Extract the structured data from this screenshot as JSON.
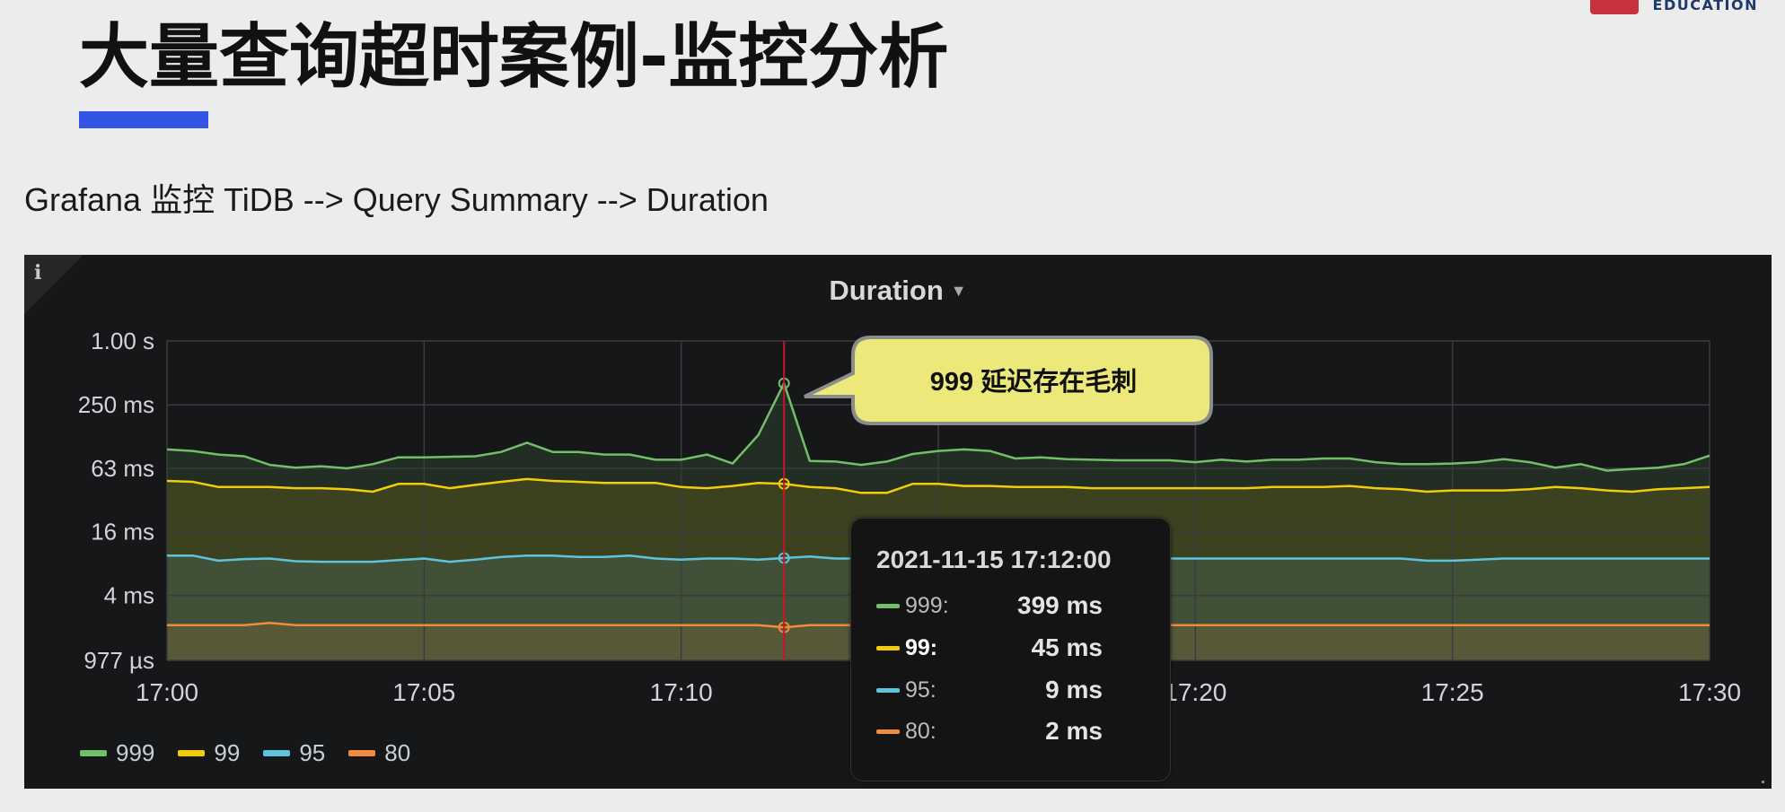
{
  "logo": {
    "text": "EDUCATION",
    "brand_color": "#c8323c"
  },
  "slide": {
    "title": "大量查询超时案例-监控分析",
    "subtitle": "Grafana 监控 TiDB --> Query Summary --> Duration",
    "accent_color": "#3355e6"
  },
  "panel": {
    "info_icon": "i",
    "title": "Duration",
    "menu_icon": "caret-down-icon",
    "background": "#161719"
  },
  "annotation": {
    "text": "999 延迟存在毛刺",
    "fill": "#ece879"
  },
  "tooltip": {
    "time": "2021-11-15 17:12:00",
    "rows": [
      {
        "name": "999:",
        "value": "399 ms",
        "color": "#73bf69",
        "highlight": false
      },
      {
        "name": "99:",
        "value": "45 ms",
        "color": "#f2cc0c",
        "highlight": true
      },
      {
        "name": "95:",
        "value": "9 ms",
        "color": "#5ec4dd",
        "highlight": false
      },
      {
        "name": "80:",
        "value": "2 ms",
        "color": "#f28c3c",
        "highlight": false
      }
    ]
  },
  "chart_data": {
    "type": "area",
    "title": "Duration",
    "y_scale": "log2",
    "ylim": [
      0.000977,
      1.0
    ],
    "y_ticks": [
      {
        "value": 1.0,
        "label": "1.00 s"
      },
      {
        "value": 0.25,
        "label": "250 ms"
      },
      {
        "value": 0.063,
        "label": "63 ms"
      },
      {
        "value": 0.016,
        "label": "16 ms"
      },
      {
        "value": 0.004,
        "label": "4 ms"
      },
      {
        "value": 0.000977,
        "label": "977 µs"
      }
    ],
    "x_ticks": [
      "17:00",
      "17:05",
      "17:10",
      "17:15",
      "17:20",
      "17:25",
      "17:30"
    ],
    "x_range": [
      "17:00",
      "17:30"
    ],
    "grid": true,
    "legend_position": "bottom-left",
    "crosshair": "17:12",
    "highlight_time": "17:12",
    "x": [
      "17:00",
      "17:00:30",
      "17:01",
      "17:01:30",
      "17:02",
      "17:02:30",
      "17:03",
      "17:03:30",
      "17:04",
      "17:04:30",
      "17:05",
      "17:05:30",
      "17:06",
      "17:06:30",
      "17:07",
      "17:07:30",
      "17:08",
      "17:08:30",
      "17:09",
      "17:09:30",
      "17:10",
      "17:10:30",
      "17:11",
      "17:11:30",
      "17:12",
      "17:12:30",
      "17:13",
      "17:13:30",
      "17:14",
      "17:14:30",
      "17:15",
      "17:15:30",
      "17:16",
      "17:16:30",
      "17:17",
      "17:17:30",
      "17:18",
      "17:18:30",
      "17:19",
      "17:19:30",
      "17:20",
      "17:20:30",
      "17:21",
      "17:21:30",
      "17:22",
      "17:22:30",
      "17:23",
      "17:23:30",
      "17:24",
      "17:24:30",
      "17:25",
      "17:25:30",
      "17:26",
      "17:26:30",
      "17:27",
      "17:27:30",
      "17:28",
      "17:28:30",
      "17:29",
      "17:29:30",
      "17:30"
    ],
    "series": [
      {
        "name": "999",
        "color": "#73bf69",
        "values": [
          0.095,
          0.092,
          0.085,
          0.082,
          0.068,
          0.064,
          0.066,
          0.063,
          0.069,
          0.08,
          0.08,
          0.081,
          0.082,
          0.09,
          0.11,
          0.09,
          0.09,
          0.085,
          0.085,
          0.076,
          0.076,
          0.085,
          0.07,
          0.13,
          0.399,
          0.074,
          0.073,
          0.068,
          0.073,
          0.086,
          0.092,
          0.095,
          0.092,
          0.078,
          0.08,
          0.077,
          0.076,
          0.075,
          0.075,
          0.075,
          0.072,
          0.076,
          0.073,
          0.076,
          0.076,
          0.078,
          0.078,
          0.072,
          0.069,
          0.069,
          0.07,
          0.072,
          0.077,
          0.072,
          0.064,
          0.069,
          0.06,
          0.062,
          0.064,
          0.069,
          0.083
        ]
      },
      {
        "name": "99",
        "color": "#f2cc0c",
        "values": [
          0.048,
          0.047,
          0.042,
          0.042,
          0.042,
          0.041,
          0.041,
          0.04,
          0.038,
          0.045,
          0.045,
          0.041,
          0.044,
          0.047,
          0.05,
          0.048,
          0.047,
          0.046,
          0.046,
          0.046,
          0.042,
          0.041,
          0.043,
          0.046,
          0.045,
          0.042,
          0.041,
          0.037,
          0.037,
          0.045,
          0.045,
          0.043,
          0.043,
          0.042,
          0.042,
          0.042,
          0.041,
          0.041,
          0.041,
          0.041,
          0.041,
          0.041,
          0.041,
          0.042,
          0.042,
          0.042,
          0.043,
          0.041,
          0.04,
          0.038,
          0.039,
          0.039,
          0.039,
          0.04,
          0.042,
          0.041,
          0.039,
          0.038,
          0.04,
          0.041,
          0.042
        ]
      },
      {
        "name": "95",
        "color": "#5ec4dd",
        "values": [
          0.0095,
          0.0095,
          0.0085,
          0.0088,
          0.0089,
          0.0084,
          0.0083,
          0.0083,
          0.0083,
          0.0086,
          0.0089,
          0.0083,
          0.0087,
          0.0092,
          0.0095,
          0.0095,
          0.0092,
          0.0092,
          0.0095,
          0.0089,
          0.0087,
          0.0089,
          0.0089,
          0.0087,
          0.009,
          0.0093,
          0.0089,
          0.0089,
          0.0089,
          0.0092,
          0.0092,
          0.0089,
          0.0089,
          0.0089,
          0.0089,
          0.0089,
          0.0089,
          0.0089,
          0.0089,
          0.0089,
          0.0089,
          0.0089,
          0.0089,
          0.0089,
          0.0089,
          0.0089,
          0.0089,
          0.0089,
          0.0089,
          0.0085,
          0.0085,
          0.0087,
          0.0089,
          0.0089,
          0.0089,
          0.0089,
          0.0089,
          0.0089,
          0.0089,
          0.0089,
          0.0089
        ]
      },
      {
        "name": "80",
        "color": "#f28c3c",
        "values": [
          0.0021,
          0.0021,
          0.0021,
          0.0021,
          0.0022,
          0.0021,
          0.0021,
          0.0021,
          0.0021,
          0.0021,
          0.0021,
          0.0021,
          0.0021,
          0.0021,
          0.0021,
          0.0021,
          0.0021,
          0.0021,
          0.0021,
          0.0021,
          0.0021,
          0.0021,
          0.0021,
          0.0021,
          0.002,
          0.0021,
          0.0021,
          0.0021,
          0.0021,
          0.0021,
          0.0021,
          0.0021,
          0.0021,
          0.0021,
          0.0021,
          0.0021,
          0.0021,
          0.0021,
          0.0021,
          0.0021,
          0.0021,
          0.0021,
          0.0021,
          0.0021,
          0.0021,
          0.0021,
          0.0021,
          0.0021,
          0.0021,
          0.0021,
          0.0021,
          0.0021,
          0.0021,
          0.0021,
          0.0021,
          0.0021,
          0.0021,
          0.0021,
          0.0021,
          0.0021,
          0.0021
        ]
      }
    ]
  }
}
